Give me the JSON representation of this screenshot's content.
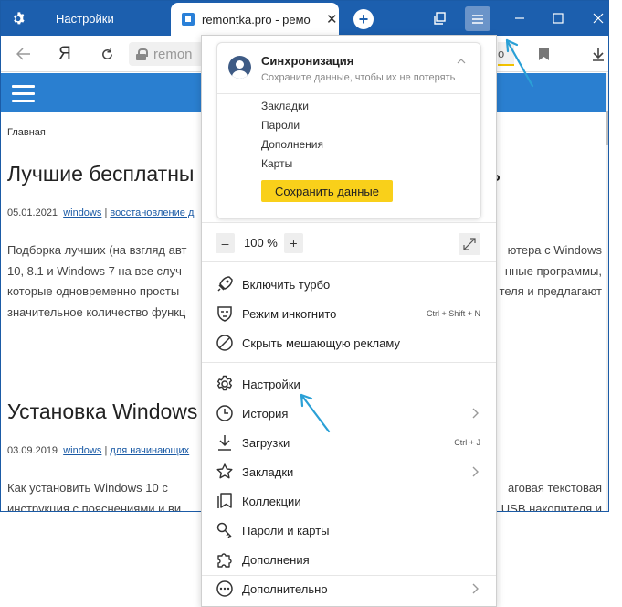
{
  "window": {
    "tab_settings_label": "Настройки",
    "tab_active_title": "remontka.pro - ремо",
    "new_tab": "+",
    "close_tab": "✕",
    "yandex_button": "Я",
    "address_text": "remon",
    "address_tail": "o"
  },
  "page": {
    "breadcrumb": "Главная",
    "article1": {
      "title": "Лучшие бесплатны",
      "title_tail": "ь",
      "date": "05.01.2021",
      "tag1": "windows",
      "sep": "|",
      "tag2": "восстановление д",
      "line1_left": "Подборка лучших (на взгляд авт",
      "line1_right": "ютера с Windows",
      "line2_left": "10, 8.1 и Windows 7 на все случ",
      "line2_right": "нные программы,",
      "line3_left": "которые одновременно просты",
      "line3_right": "теля и предлагают",
      "line4_left": "значительное количество функц"
    },
    "article2": {
      "title": "Установка Windows",
      "date": "03.09.2019",
      "tag1": "windows",
      "sep": "|",
      "tag2": "для начинающих",
      "line1_left": "Как установить Windows 10 с",
      "line1_right": "аговая текстовая",
      "line2_left": "инструкция с пояснениями и ви",
      "line2_right": "USB накопителя и"
    }
  },
  "menu": {
    "sync": {
      "title": "Синхронизация",
      "subtitle": "Сохраните данные, чтобы их не потерять",
      "items": [
        "Закладки",
        "Пароли",
        "Дополнения",
        "Карты"
      ],
      "save_button": "Сохранить данные"
    },
    "zoom": {
      "minus": "–",
      "value": "100 %",
      "plus": "+"
    },
    "items": [
      {
        "icon": "rocket-icon",
        "label": "Включить турбо",
        "shortcut": "",
        "submenu": false
      },
      {
        "icon": "incognito-mask-icon",
        "label": "Режим инкогнито",
        "shortcut": "Ctrl + Shift + N",
        "submenu": false
      },
      {
        "icon": "block-ads-icon",
        "label": "Скрыть мешающую рекламу",
        "shortcut": "",
        "submenu": false
      },
      {
        "icon": "gear-icon",
        "label": "Настройки",
        "shortcut": "",
        "submenu": false
      },
      {
        "icon": "clock-icon",
        "label": "История",
        "shortcut": "",
        "submenu": true
      },
      {
        "icon": "download-icon",
        "label": "Загрузки",
        "shortcut": "Ctrl + J",
        "submenu": false
      },
      {
        "icon": "star-icon",
        "label": "Закладки",
        "shortcut": "",
        "submenu": true
      },
      {
        "icon": "collections-icon",
        "label": "Коллекции",
        "shortcut": "",
        "submenu": false
      },
      {
        "icon": "key-icon",
        "label": "Пароли и карты",
        "shortcut": "",
        "submenu": false
      },
      {
        "icon": "puzzle-icon",
        "label": "Дополнения",
        "shortcut": "",
        "submenu": false
      },
      {
        "icon": "more-icon",
        "label": "Дополнительно",
        "shortcut": "",
        "submenu": true
      }
    ]
  },
  "colors": {
    "titlebar": "#1c5fae",
    "site_header": "#2a7fd0",
    "save_button": "#f9d01a",
    "link": "#1a5aa5",
    "annotation_arrow": "#2aa0d6"
  }
}
